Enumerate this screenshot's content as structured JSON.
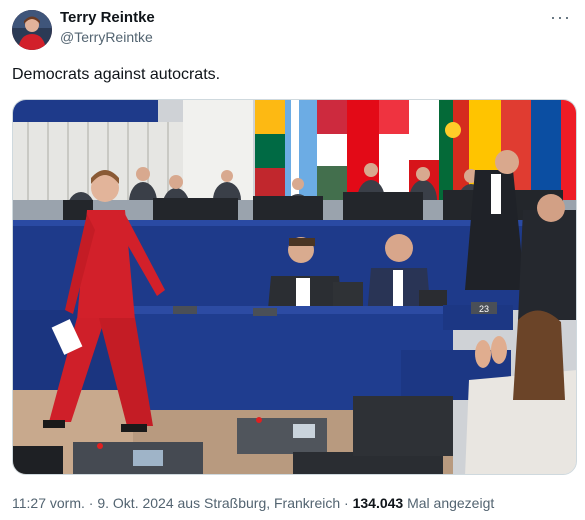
{
  "tweet": {
    "display_name": "Terry Reintke",
    "handle": "@TerryReintke",
    "more_icon": "more-icon",
    "text": "Democrats against autocrats.",
    "footer": {
      "time": "11:27 vorm.",
      "separator": "·",
      "date": "9. Okt. 2024",
      "location": "aus Straßburg, Frankreich",
      "views": "134.043",
      "views_label": "Mal angezeigt"
    }
  },
  "photo": {
    "seat_number": "23"
  },
  "colors": {
    "text_primary": "#0f1419",
    "text_secondary": "#536471",
    "border": "#cfd9de",
    "suit_red": "#d2202a",
    "parliament_blue": "#1e3a8a"
  }
}
